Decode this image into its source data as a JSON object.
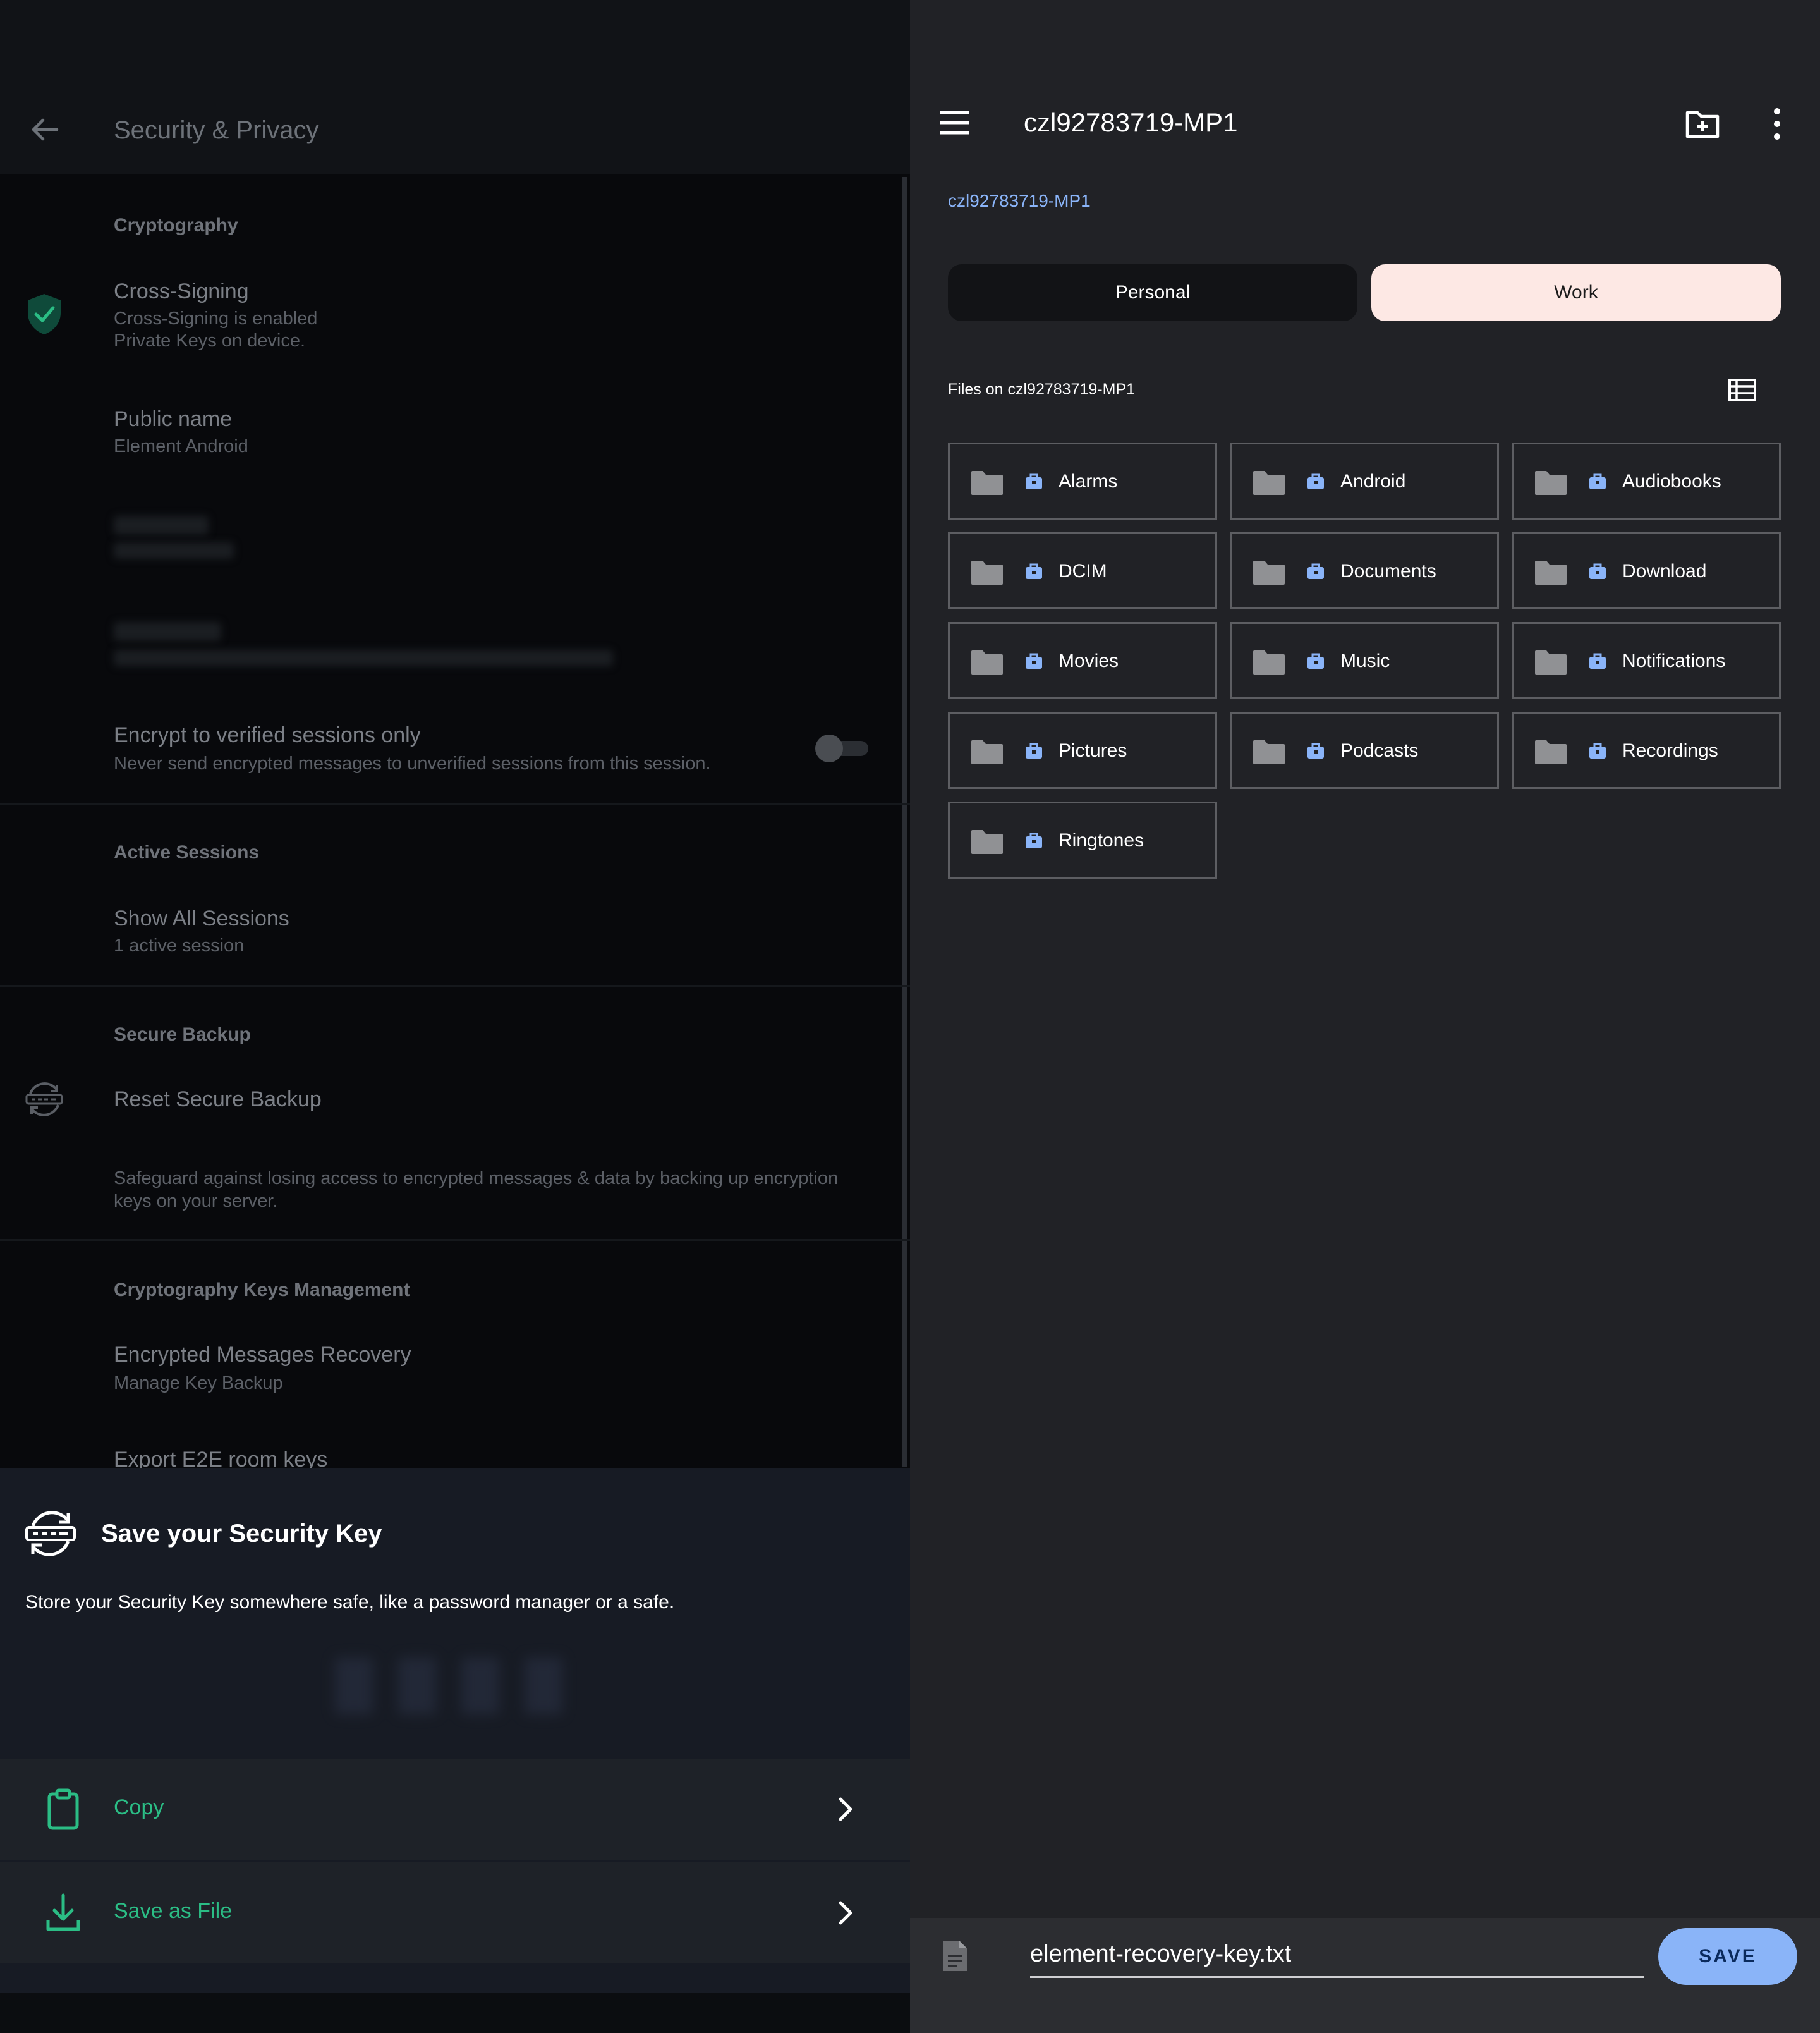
{
  "left": {
    "header": {
      "title": "Security & Privacy"
    },
    "cryptography": {
      "section_title": "Cryptography",
      "cross_signing": {
        "title": "Cross-Signing",
        "line1": "Cross-Signing is enabled",
        "line2": "Private Keys on device."
      },
      "public_name": {
        "title": "Public name",
        "value": "Element Android"
      },
      "encrypt_verified": {
        "title": "Encrypt to verified sessions only",
        "subtitle": "Never send encrypted messages to unverified sessions from this session.",
        "enabled": false
      }
    },
    "active_sessions": {
      "section_title": "Active Sessions",
      "show_all": {
        "title": "Show All Sessions",
        "subtitle": "1 active session"
      }
    },
    "secure_backup": {
      "section_title": "Secure Backup",
      "reset": {
        "title": "Reset Secure Backup"
      },
      "description": "Safeguard against losing access to encrypted messages & data by backing up encryption keys on your server."
    },
    "keys_management": {
      "section_title": "Cryptography Keys Management",
      "recovery": {
        "title": "Encrypted Messages Recovery",
        "subtitle": "Manage Key Backup"
      },
      "export": {
        "title": "Export E2E room keys"
      }
    },
    "sheet": {
      "title": "Save your Security Key",
      "description": "Store your Security Key somewhere safe, like a password manager or a safe.",
      "copy_label": "Copy",
      "save_file_label": "Save as File"
    }
  },
  "right": {
    "header": {
      "title": "czl92783719-MP1"
    },
    "breadcrumb": "czl92783719-MP1",
    "tabs": [
      {
        "label": "Personal",
        "selected": false
      },
      {
        "label": "Work",
        "selected": true
      }
    ],
    "files_label": "Files on czl92783719-MP1",
    "folders": [
      "Alarms",
      "Android",
      "Audiobooks",
      "DCIM",
      "Documents",
      "Download",
      "Movies",
      "Music",
      "Notifications",
      "Pictures",
      "Podcasts",
      "Recordings",
      "Ringtones"
    ],
    "save_bar": {
      "filename": "element-recovery-key.txt",
      "save_label": "SAVE"
    }
  },
  "colors": {
    "accent_green": "#2bbd85",
    "accent_blue": "#8ab4f8",
    "work_tab": "#fde8e4"
  }
}
